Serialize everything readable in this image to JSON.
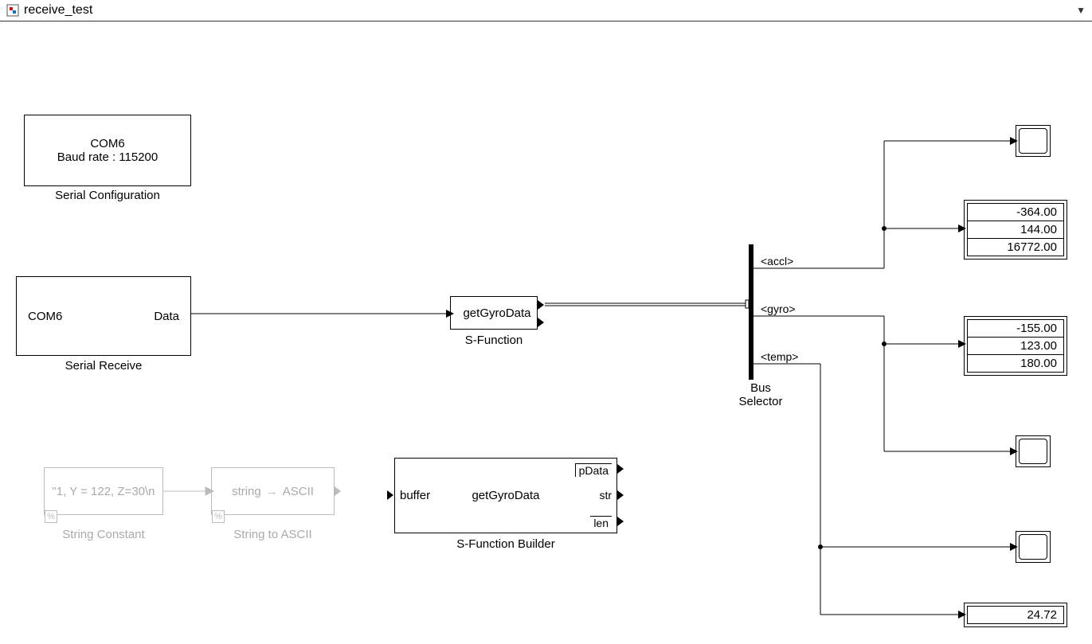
{
  "title": "receive_test",
  "blocks": {
    "serial_config": {
      "line1": "COM6",
      "line2": "Baud rate : 115200",
      "label": "Serial Configuration"
    },
    "serial_receive": {
      "port": "COM6",
      "out": "Data",
      "label": "Serial Receive"
    },
    "sfunction": {
      "text": "getGyroData",
      "label": "S-Function"
    },
    "bus_selector": {
      "label": "Bus\nSelector",
      "sig1": "<accl>",
      "sig2": "<gyro>",
      "sig3": "<temp>"
    },
    "string_constant": {
      "text": "\"1, Y = 122, Z=30\\n",
      "label": "String Constant"
    },
    "string_to_ascii": {
      "in": "string",
      "out": "ASCII",
      "label": "String to ASCII"
    },
    "sfbuilder": {
      "in": "buffer",
      "name": "getGyroData",
      "out1": "pData",
      "out2": "str",
      "out3": "len",
      "label": "S-Function Builder"
    }
  },
  "displays": {
    "accl": [
      "-364.00",
      "144.00",
      "16772.00"
    ],
    "gyro": [
      "-155.00",
      "123.00",
      "180.00"
    ],
    "temp": [
      "24.72"
    ]
  }
}
